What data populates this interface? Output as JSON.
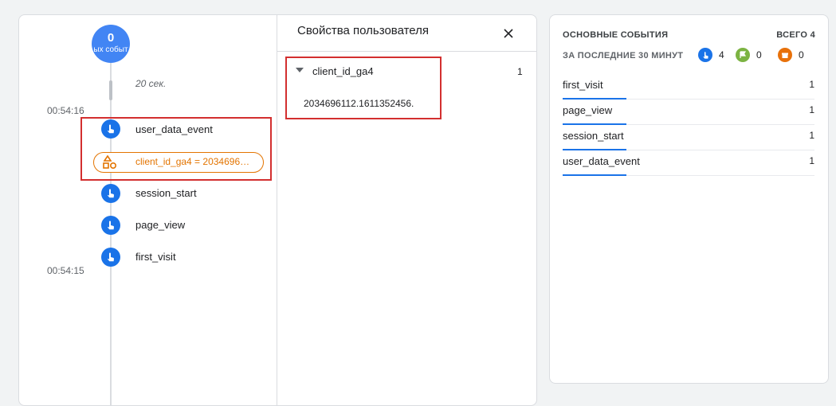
{
  "timeline": {
    "counter_value": "0",
    "counter_label": "ых событ",
    "gap_label": "20 сек.",
    "times": [
      "00:54:16",
      "00:54:15"
    ],
    "events": [
      {
        "label": "user_data_event"
      },
      {
        "label": "session_start"
      },
      {
        "label": "page_view"
      },
      {
        "label": "first_visit"
      }
    ],
    "param_chip": "client_id_ga4 = 2034696…"
  },
  "user_properties": {
    "title": "Свойства пользователя",
    "property_name": "client_id_ga4",
    "property_count": "1",
    "property_value": "2034696112.1611352456."
  },
  "top_events": {
    "title": "ОСНОВНЫЕ СОБЫТИЯ",
    "total": "ВСЕГО 4",
    "subtitle": "ЗА ПОСЛЕДНИЕ 30 МИНУТ",
    "stats": [
      {
        "value": "4",
        "icon": "touch-icon",
        "color": "#1a73e8"
      },
      {
        "value": "0",
        "icon": "flag-icon",
        "color": "#7cb342"
      },
      {
        "value": "0",
        "icon": "gift-icon",
        "color": "#e8710a"
      }
    ],
    "rows": [
      {
        "name": "first_visit",
        "count": "1"
      },
      {
        "name": "page_view",
        "count": "1"
      },
      {
        "name": "session_start",
        "count": "1"
      },
      {
        "name": "user_data_event",
        "count": "1"
      }
    ]
  },
  "colors": {
    "accent": "#1a73e8",
    "param": "#e37400",
    "highlight": "#d32f2f"
  }
}
